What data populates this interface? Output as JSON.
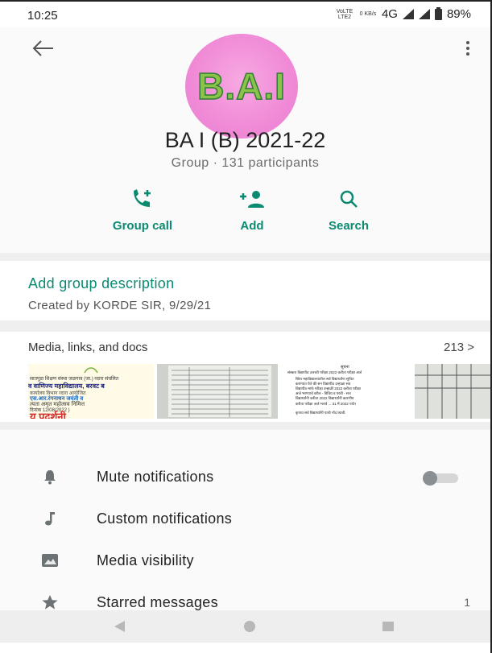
{
  "status_bar": {
    "time": "10:25",
    "volte": "VoLTE LTE2",
    "speed": "0 KB/s",
    "network": "4G",
    "battery": "89%"
  },
  "header": {
    "avatar_text": "B.A.I",
    "title": "BA I (B) 2021-22",
    "subtitle": "Group · 131 participants",
    "back_icon": "arrow-left-icon",
    "menu_icon": "more-vert-icon"
  },
  "actions": [
    {
      "label": "Group call",
      "icon": "phone-plus-icon"
    },
    {
      "label": "Add",
      "icon": "add-person-icon"
    },
    {
      "label": "Search",
      "icon": "search-icon"
    }
  ],
  "description": {
    "add_label": "Add group description",
    "created": "Created by KORDE SIR, 9/29/21"
  },
  "media": {
    "heading": "Media, links, and docs",
    "count": "213 >",
    "thumbnails": [
      {
        "lines": [
          "सातपुडा शिक्षण संस्था जळगाव (जा.) व्दारा संचलित",
          "व वाणिज्य महाविद्यालय, बरवट ब",
          "कार्यालय विभाग व्दारा आयोजित",
          "एस.आर.रंगनाथन जयंती व",
          "त्यता अमृत महोत्सव निमित्त",
          "दिनांक 12/08/2022 )",
          "य प्रदर्शनी"
        ]
      },
      {
        "lines": []
      },
      {
        "lines": [
          "सूचना",
          "संस्करा विद्यापीठ उत्तरवी परीक्षा 2022 करीता परीक्षा अर्ज",
          "स्विय महाविद्यालयातील सर्व विद्यार्थ्यांना सूचित",
          "करण्यात येते की सन विद्यापीठ उन्हाळा सत्र",
          "विद्यापीठ मार्फ परीक्षा उन्हाळी 2022 करीता परीक्षा",
          "अर्ज भरण्याचे वरील - विविध व परवी - सच",
          "विद्यार्थ्यांनी करीता 2022 विद्यार्थ्यांनी कारणीय",
          "करीता परीक्षा अर्ज भरावे ... 31 में 2022 पर्यंत",
          "कृपया सर्व विद्यार्थ्यांनी याची नोंद घ्यावी."
        ]
      },
      {
        "lines": []
      }
    ]
  },
  "settings": [
    {
      "label": "Mute notifications",
      "icon": "bell-icon",
      "toggle": false
    },
    {
      "label": "Custom notifications",
      "icon": "music-note-icon"
    },
    {
      "label": "Media visibility",
      "icon": "image-icon"
    },
    {
      "label": "Starred messages",
      "icon": "star-icon",
      "count": "1"
    }
  ],
  "nav": {
    "back": "triangle-back-icon",
    "home": "circle-home-icon",
    "recents": "square-recents-icon"
  },
  "colors": {
    "accent": "#0b8a72",
    "avatar_bg": "#f08ad7",
    "avatar_text": "#8bc34a"
  }
}
